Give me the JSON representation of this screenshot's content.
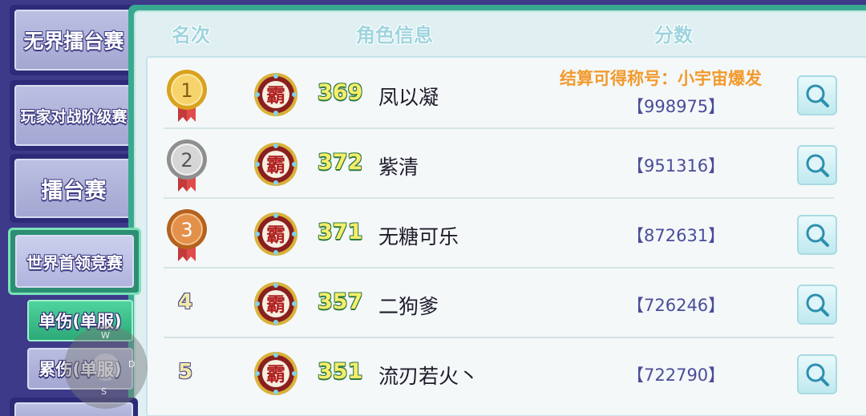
{
  "sidebar": {
    "tabs": [
      {
        "label": "无界擂台赛"
      },
      {
        "label": "玩家对战阶级赛"
      },
      {
        "label": "擂台赛"
      },
      {
        "label": "世界首领竞赛",
        "selected": true
      }
    ],
    "subtabs": [
      {
        "label": "单伤(单服)",
        "selected": true
      },
      {
        "label": "累伤(单服)"
      }
    ]
  },
  "joystick": {
    "up": "W",
    "right": "D",
    "down": "S"
  },
  "headers": {
    "rank": "名次",
    "role": "角色信息",
    "score": "分数"
  },
  "rows": [
    {
      "rank": "1",
      "medal": "gold",
      "level": "369",
      "name": "凤以凝",
      "score": "【998975】",
      "note": "结算可得称号：小宇宙爆发"
    },
    {
      "rank": "2",
      "medal": "silver",
      "level": "372",
      "name": "紫清",
      "score": "【951316】"
    },
    {
      "rank": "3",
      "medal": "bronze",
      "level": "371",
      "name": "无糖可乐",
      "score": "【872631】"
    },
    {
      "rank": "4",
      "medal": "none",
      "level": "357",
      "name": "二狗爹",
      "score": "【726246】"
    },
    {
      "rank": "5",
      "medal": "none",
      "level": "351",
      "name": "流刃若火丶",
      "score": "【722790】"
    }
  ],
  "colors": {
    "accent_green": "#3aa891",
    "score_text": "#4b4c99",
    "note_text": "#f29a2d",
    "level_text": "#f7ed6a"
  }
}
